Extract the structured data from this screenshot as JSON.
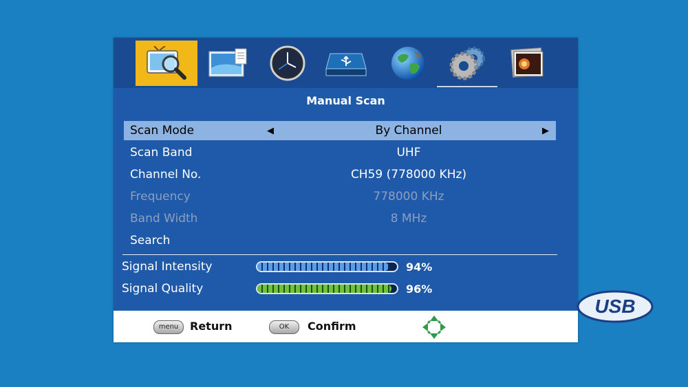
{
  "menu_tabs": [
    {
      "name": "channel-search-icon"
    },
    {
      "name": "picture-icon"
    },
    {
      "name": "clock-icon"
    },
    {
      "name": "usb-device-icon"
    },
    {
      "name": "globe-icon"
    },
    {
      "name": "settings-gears-icon"
    },
    {
      "name": "media-photo-icon"
    }
  ],
  "active_tab": 0,
  "title": "Manual Scan",
  "rows": [
    {
      "label": "Scan Mode",
      "value": "By Channel"
    },
    {
      "label": "Scan Band",
      "value": "UHF"
    },
    {
      "label": "Channel No.",
      "value": "CH59 (778000 KHz)"
    },
    {
      "label": "Frequency",
      "value": "778000 KHz"
    },
    {
      "label": "Band Width",
      "value": "8 MHz"
    },
    {
      "label": "Search",
      "value": ""
    }
  ],
  "signal": {
    "intensity": {
      "label": "Signal Intensity",
      "percent_text": "94%",
      "level": 0.94
    },
    "quality": {
      "label": "Signal Quality",
      "percent_text": "96%",
      "level": 0.96
    }
  },
  "footer": {
    "menu_key": "menu",
    "return_label": "Return",
    "ok_key": "OK",
    "confirm_label": "Confirm"
  },
  "usb_logo_text": "USB",
  "colors": {
    "panel": "#1f5aaa",
    "selected_row": "#8db3e2",
    "active_tab": "#f2b81a",
    "intensity_bar": "#5b9be8",
    "quality_bar": "#6fc23a"
  }
}
